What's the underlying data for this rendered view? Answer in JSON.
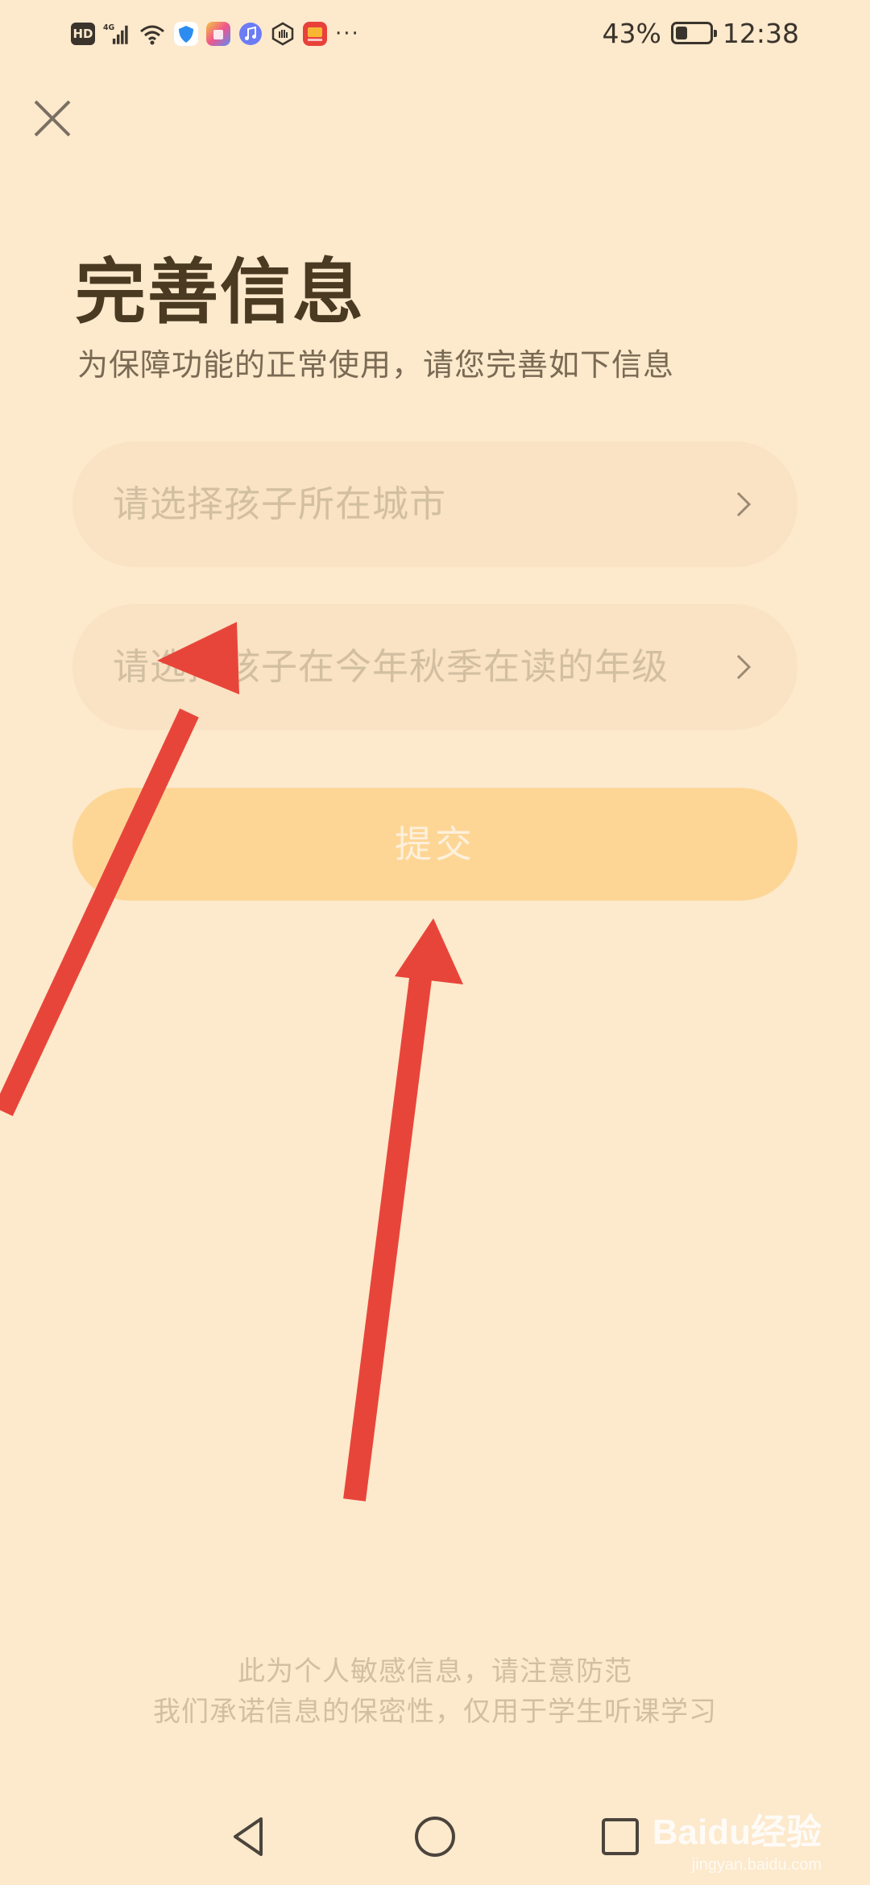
{
  "status_bar": {
    "network_label": "4G",
    "hd_label": "HD",
    "more": "···",
    "battery_percent": "43%",
    "battery_level": 0.43,
    "time": "12:38"
  },
  "close_icon": "close-icon",
  "header": {
    "title": "完善信息",
    "subtitle": "为保障功能的正常使用，请您完善如下信息"
  },
  "form": {
    "city_placeholder": "请选择孩子所在城市",
    "grade_placeholder": "请选择孩子在今年秋季在读的年级",
    "submit_label": "提交"
  },
  "footer": {
    "line1": "此为个人敏感信息，请注意防范",
    "line2": "我们承诺信息的保密性，仅用于学生听课学习"
  },
  "nav": {
    "back": "back-icon",
    "home": "home-icon",
    "recent": "recent-apps-icon"
  },
  "watermark": {
    "text": "Baidu经验",
    "sub": "jingyan.baidu.com"
  },
  "colors": {
    "background": "#fde9cc",
    "title": "#4a3a22",
    "submit": "#fdd696",
    "arrow": "#e8453a"
  }
}
